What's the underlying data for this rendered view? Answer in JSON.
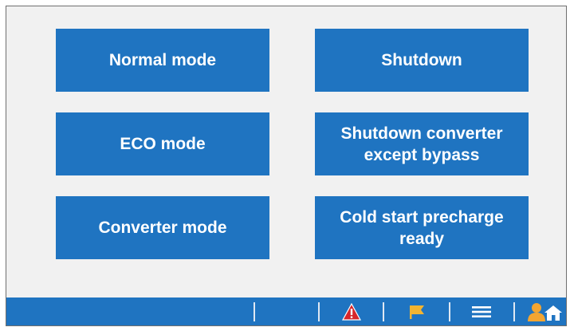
{
  "mode_buttons": {
    "normal": "Normal mode",
    "eco": "ECO mode",
    "converter": "Converter mode",
    "shutdown": "Shutdown",
    "shutdown_except_bypass": "Shutdown converter\nexcept bypass",
    "cold_start": "Cold start precharge\nready"
  },
  "colors": {
    "button_blue": "#1f74c1",
    "background": "#f1f1f1",
    "alarm_red": "#d7262b",
    "flag_yellow": "#f2b431",
    "user_orange": "#f3a531"
  },
  "status_bar": {
    "icons": [
      "alarm-warning-icon",
      "flag-icon",
      "menu-icon",
      "user-home-icon"
    ]
  }
}
